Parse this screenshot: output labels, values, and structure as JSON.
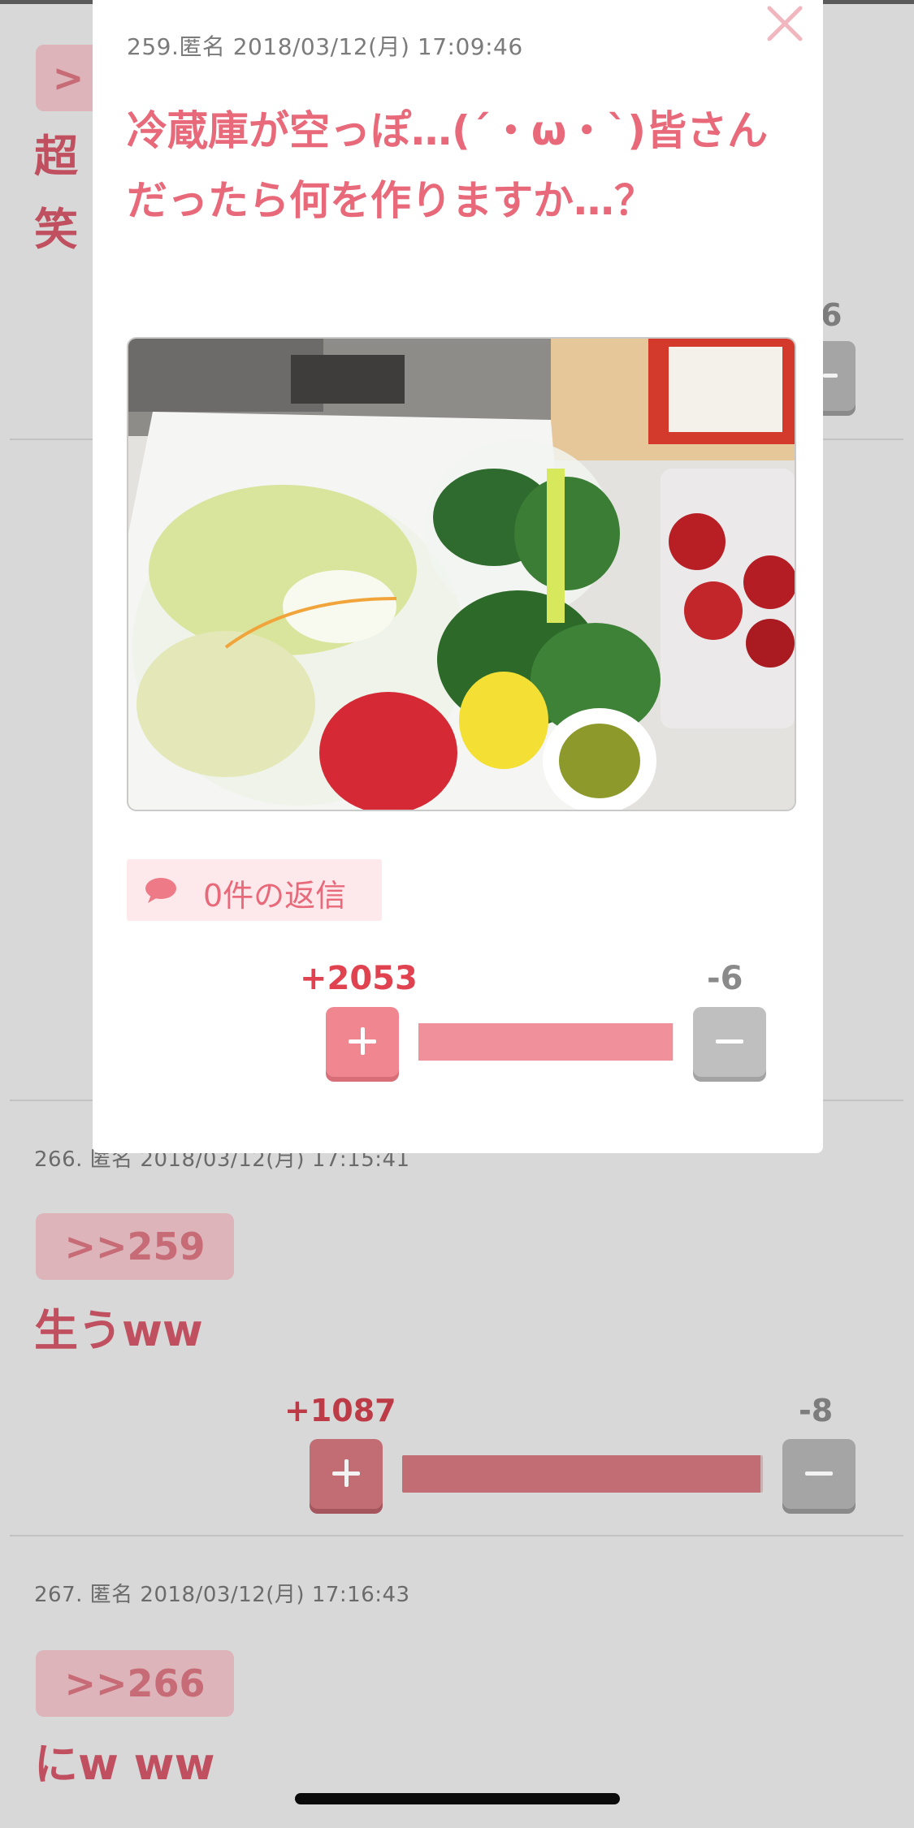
{
  "background_posts": {
    "prev_post": {
      "anchor_partial": ">",
      "lines_partial": [
        "超",
        "笑"
      ],
      "minus_partial": "6"
    },
    "post_266": {
      "meta": "266. 匿名 2018/03/12(月) 17:15:41",
      "anchor": ">>259",
      "body": "生うww",
      "plus_votes": "+1087",
      "minus_votes": "-8",
      "plus_share": 0.993
    },
    "post_267": {
      "meta": "267. 匿名 2018/03/12(月) 17:16:43",
      "anchor": ">>266",
      "body": "にw ww"
    }
  },
  "modal": {
    "meta": "259.匿名 2018/03/12(月) 17:09:46",
    "title": "冷蔵庫が空っぽ…(´・ω・`)皆さんだったら何を作りますか…？",
    "image_icon": "photo-vegetables",
    "reply_icon": "speech-bubble-icon",
    "reply_label": "0件の返信",
    "plus_votes": "+2053",
    "minus_votes": "-6",
    "plus_share": 0.997,
    "close_icon": "close-icon"
  },
  "colors": {
    "accent": "#e86a7a",
    "plus": "#e0434f",
    "overlay": "#d8d8d8"
  }
}
